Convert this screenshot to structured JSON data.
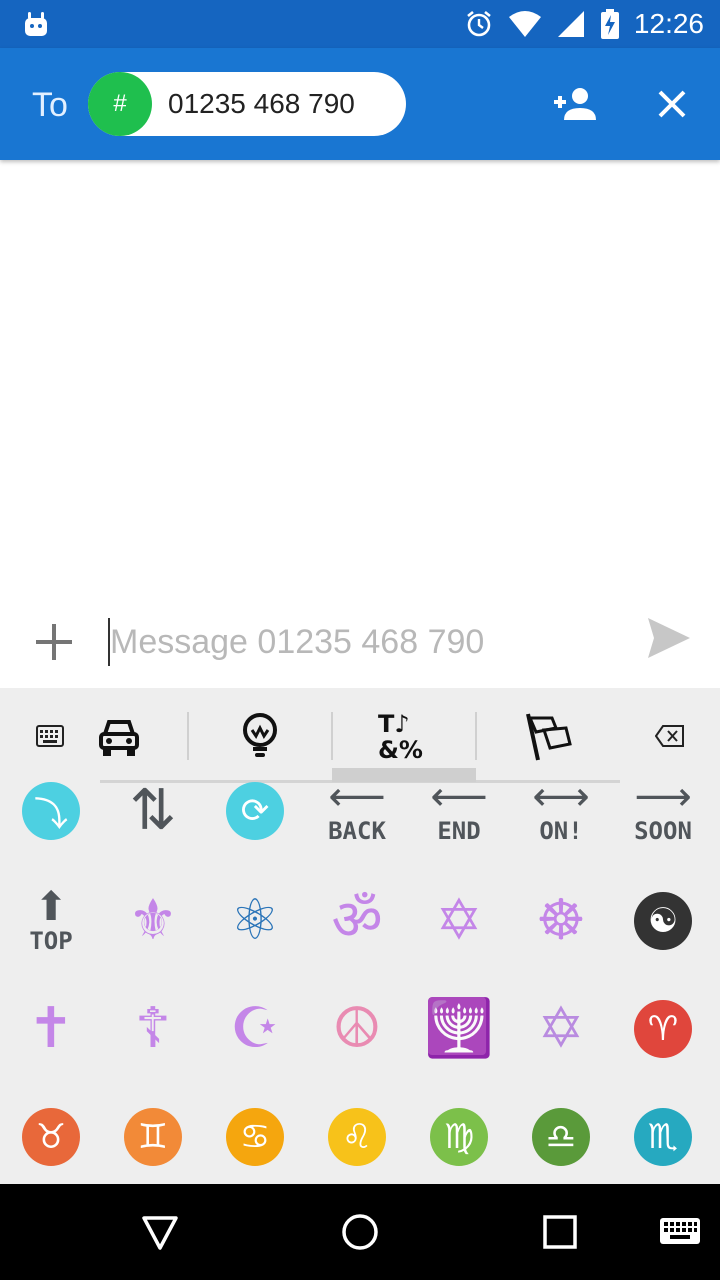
{
  "status_bar": {
    "time": "12:26",
    "icons": [
      "android-notification-icon",
      "alarm-icon",
      "wifi-icon",
      "signal-icon",
      "battery-charging-icon"
    ]
  },
  "app_bar": {
    "to_label": "To",
    "recipient_avatar": "#",
    "recipient_number": "01235 468 790",
    "icons": [
      "add-person-icon",
      "close-icon"
    ]
  },
  "compose": {
    "placeholder": "Message 01235 468 790",
    "value": "",
    "icons": [
      "plus-icon",
      "send-icon"
    ]
  },
  "keyboard": {
    "categories": [
      "keyboard-icon",
      "car-icon",
      "lightbulb-icon",
      "symbols-icon",
      "flags-icon",
      "backspace-icon"
    ],
    "active_category": "symbols-icon",
    "row1": [
      {
        "kind": "circle",
        "glyph": "⤵",
        "color": "#4dd0e1",
        "name": "return-arrow-emoji"
      },
      {
        "kind": "plain",
        "glyph": "⇅",
        "color": "#50555a",
        "name": "up-down-arrows-emoji"
      },
      {
        "kind": "circle",
        "glyph": "⟳",
        "color": "#4dd0e1",
        "name": "refresh-arrows-emoji"
      },
      {
        "kind": "word",
        "word": "BACK",
        "arrow": "⟵",
        "name": "back-arrow-emoji"
      },
      {
        "kind": "word",
        "word": "END",
        "arrow": "⟵",
        "name": "end-arrow-emoji"
      },
      {
        "kind": "word",
        "word": "ON!",
        "arrow": "⟷",
        "name": "on-arrow-emoji"
      },
      {
        "kind": "word",
        "word": "SOON",
        "arrow": "⟶",
        "name": "soon-arrow-emoji"
      }
    ],
    "row2": [
      {
        "kind": "word",
        "word": "TOP",
        "arrow": "⬆",
        "name": "top-arrow-emoji"
      },
      {
        "kind": "plain",
        "glyph": "⚜",
        "color": "#c486e8",
        "name": "vibration-mode-emoji"
      },
      {
        "kind": "plain",
        "glyph": "⚛",
        "color": "#2a74b8",
        "name": "atom-emoji"
      },
      {
        "kind": "plain",
        "glyph": "ॐ",
        "color": "#c486e8",
        "name": "om-emoji"
      },
      {
        "kind": "plain",
        "glyph": "✡",
        "color": "#c486e8",
        "name": "star-of-david-emoji"
      },
      {
        "kind": "plain",
        "glyph": "☸",
        "color": "#c486e8",
        "name": "wheel-of-dharma-emoji"
      },
      {
        "kind": "circle",
        "glyph": "☯",
        "color": "#333333",
        "name": "yin-yang-emoji"
      }
    ],
    "row3": [
      {
        "kind": "plain",
        "glyph": "✝",
        "color": "#c486e8",
        "name": "latin-cross-emoji"
      },
      {
        "kind": "plain",
        "glyph": "☦",
        "color": "#c486e8",
        "name": "orthodox-cross-emoji"
      },
      {
        "kind": "plain",
        "glyph": "☪",
        "color": "#c486e8",
        "name": "star-and-crescent-emoji"
      },
      {
        "kind": "plain",
        "glyph": "☮",
        "color": "#e98bb2",
        "name": "peace-symbol-emoji"
      },
      {
        "kind": "plain",
        "glyph": "🕎",
        "color": "#f0a818",
        "name": "menorah-emoji"
      },
      {
        "kind": "plain",
        "glyph": "✡",
        "color": "#b98be0",
        "name": "six-pointed-star-emoji"
      },
      {
        "kind": "circle",
        "glyph": "♈",
        "color": "#e0463c",
        "name": "aries-emoji"
      }
    ],
    "row4": [
      {
        "kind": "circle",
        "glyph": "♉",
        "color": "#e8683a",
        "name": "taurus-emoji"
      },
      {
        "kind": "circle",
        "glyph": "♊",
        "color": "#f28a38",
        "name": "gemini-emoji"
      },
      {
        "kind": "circle",
        "glyph": "♋",
        "color": "#f5a60e",
        "name": "cancer-emoji"
      },
      {
        "kind": "circle",
        "glyph": "♌",
        "color": "#f7c21a",
        "name": "leo-emoji"
      },
      {
        "kind": "circle",
        "glyph": "♍",
        "color": "#7cc04a",
        "name": "virgo-emoji"
      },
      {
        "kind": "circle",
        "glyph": "♎",
        "color": "#5a9a3a",
        "name": "libra-emoji"
      },
      {
        "kind": "circle",
        "glyph": "♏",
        "color": "#26a9c0",
        "name": "scorpio-emoji"
      }
    ]
  },
  "nav_bar": {
    "icons": [
      "back-triangle-icon",
      "home-circle-icon",
      "recents-square-icon",
      "keyboard-switch-icon"
    ]
  },
  "colors": {
    "status_bar": "#1565c0",
    "app_bar": "#1976d2",
    "chip_avatar": "#1fbf4e",
    "keyboard_bg": "#eeeeee"
  }
}
